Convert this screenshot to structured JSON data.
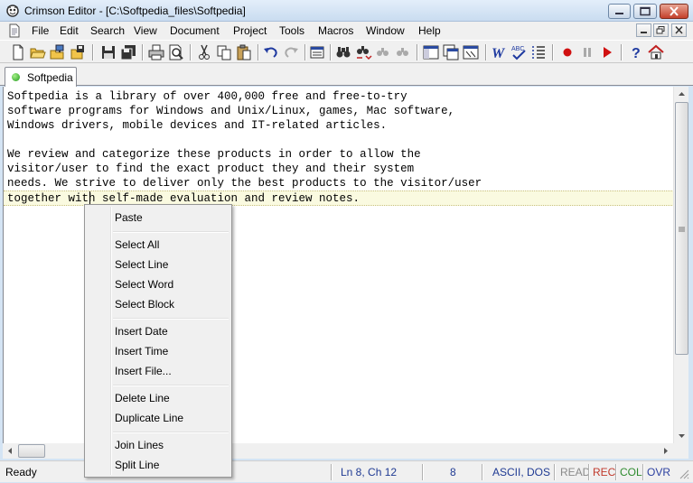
{
  "window": {
    "title": "Crimson Editor - [C:\\Softpedia_files\\Softpedia]"
  },
  "menubar": {
    "items": [
      "File",
      "Edit",
      "Search",
      "View",
      "Document",
      "Project",
      "Tools",
      "Macros",
      "Window",
      "Help"
    ]
  },
  "toolbar": {
    "buttons": [
      "new-icon",
      "open-icon",
      "open-remote-icon",
      "save-as-icon",
      "save-icon",
      "save-all-icon",
      "print-icon",
      "print-preview-icon",
      "cut-icon",
      "copy-icon",
      "paste-icon",
      "undo-icon",
      "redo-icon",
      "column-mode-icon",
      "find-icon",
      "replace-icon",
      "find-next-icon",
      "find-prev-icon",
      "toggle-panel-icon",
      "output-window-icon",
      "directory-tree-icon",
      "word-wrap-icon",
      "spell-check-icon",
      "line-numbers-icon",
      "record-macro-icon",
      "pause-macro-icon",
      "play-macro-icon",
      "help-icon",
      "home-icon"
    ]
  },
  "tabs": [
    {
      "label": "Softpedia",
      "active": true
    }
  ],
  "editor": {
    "lines": [
      "Softpedia is a library of over 400,000 free and free-to-try",
      "software programs for Windows and Unix/Linux, games, Mac software,",
      "Windows drivers, mobile devices and IT-related articles.",
      "",
      "We review and categorize these products in order to allow the",
      "visitor/user to find the exact product they and their system",
      "needs. We strive to deliver only the best products to the visitor/user",
      "together with self-made evaluation and review notes."
    ],
    "current_line": 8
  },
  "context_menu": {
    "groups": [
      [
        "Paste"
      ],
      [
        "Select All",
        "Select Line",
        "Select Word",
        "Select Block"
      ],
      [
        "Insert Date",
        "Insert Time",
        "Insert File..."
      ],
      [
        "Delete Line",
        "Duplicate Line"
      ],
      [
        "Join Lines",
        "Split Line"
      ]
    ]
  },
  "statusbar": {
    "status": "Ready",
    "position": "Ln 8, Ch 12",
    "count": "8",
    "encoding": "ASCII, DOS",
    "read": "READ",
    "rec": "REC",
    "col": "COL",
    "ovr": "OVR"
  },
  "colors": {
    "read": "#8a8a8a",
    "rec": "#c0392b",
    "col": "#2e8b2e",
    "ovr": "#2b3fa0",
    "status_blue": "#1f3a93",
    "current_line_bg": "#fafae0"
  }
}
